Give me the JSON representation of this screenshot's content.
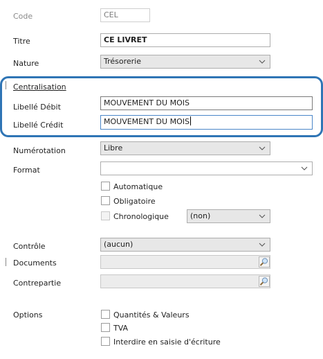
{
  "form": {
    "code": {
      "label": "Code",
      "value": "CEL"
    },
    "titre": {
      "label": "Titre",
      "value": "CE LIVRET"
    },
    "nature": {
      "label": "Nature",
      "value": "Trésorerie"
    },
    "centralisation": {
      "label": "Centralisation"
    },
    "libelle_debit": {
      "label": "Libellé Débit",
      "value": "MOUVEMENT DU MOIS"
    },
    "libelle_credit": {
      "label": "Libellé Crédit",
      "value": "MOUVEMENT DU MOIS"
    },
    "numerotation": {
      "label": "Numérotation",
      "value": "Libre"
    },
    "format": {
      "label": "Format",
      "value": ""
    },
    "format_options": {
      "automatique": {
        "label": "Automatique",
        "checked": false
      },
      "obligatoire": {
        "label": "Obligatoire",
        "checked": false
      },
      "chronologique": {
        "label": "Chronologique",
        "checked": false,
        "select_value": "(non)"
      }
    },
    "controle": {
      "label": "Contrôle",
      "value": "(aucun)"
    },
    "documents": {
      "label": "Documents",
      "value": ""
    },
    "contrepartie": {
      "label": "Contrepartie",
      "value": ""
    },
    "options": {
      "label": "Options",
      "items": [
        {
          "label": "Quantités & Valeurs",
          "checked": false
        },
        {
          "label": "TVA",
          "checked": false
        },
        {
          "label": "Interdire en saisie d'écriture",
          "checked": false
        }
      ]
    }
  },
  "colors": {
    "highlight": "#2f75b5",
    "field_border": "#adadad",
    "combo_bg": "#e7e7e7"
  },
  "icons": {
    "dropdown": "chevron-down-icon",
    "lookup": "search-lookup-icon"
  }
}
